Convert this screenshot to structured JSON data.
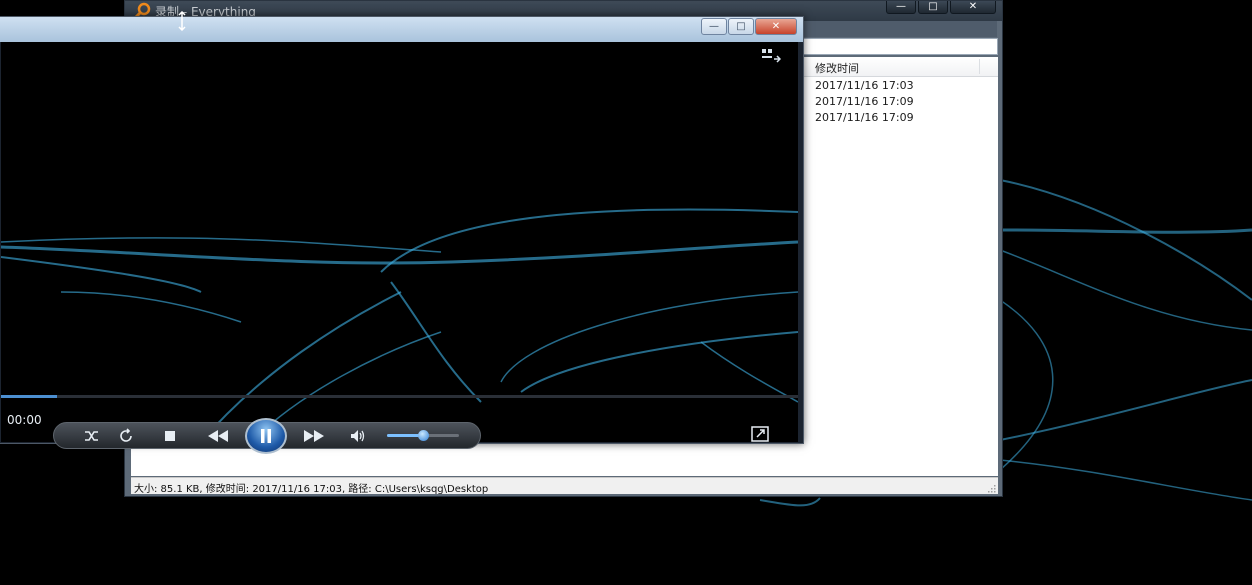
{
  "everything_window": {
    "title": "录制 - Everything",
    "columns": {
      "modified": "修改时间"
    },
    "rows": [
      {
        "modified": "2017/11/16 17:03"
      },
      {
        "modified": "2017/11/16 17:09"
      },
      {
        "modified": "2017/11/16 17:09"
      }
    ],
    "status": "大小: 85.1 KB, 修改时间: 2017/11/16 17:03, 路径: C:\\Users\\ksqg\\Desktop",
    "buttons": {
      "minimize": "—",
      "maximize": "□",
      "close": "✕"
    }
  },
  "media_player": {
    "time": "00:00",
    "progress": 0.07,
    "volume": 0.5,
    "buttons": {
      "minimize": "—",
      "maximize": "□",
      "close": "✕"
    },
    "controls": [
      "shuffle-icon",
      "repeat-icon",
      "stop-icon",
      "previous-icon",
      "pause-icon",
      "next-icon",
      "volume-icon",
      "switch-to-now-playing-icon",
      "fullscreen-icon"
    ]
  },
  "colors": {
    "accent": "#4c8fd1",
    "wave": "#3fb3e6"
  }
}
